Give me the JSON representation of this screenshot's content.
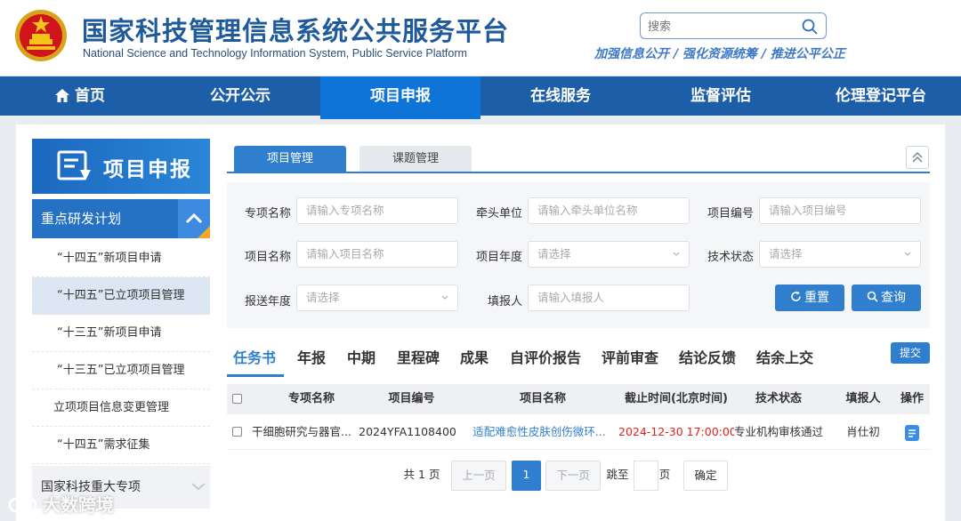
{
  "header": {
    "title_cn": "国家科技管理信息系统公共服务平台",
    "title_en": "National Science and Technology Information System, Public Service Platform",
    "search_placeholder": "搜索",
    "slogan": "加强信息公开 / 强化资源统筹 / 推进公平公正"
  },
  "nav": [
    {
      "label": "首页",
      "icon": "home-icon"
    },
    {
      "label": "公开公示"
    },
    {
      "label": "项目申报",
      "active": true
    },
    {
      "label": "在线服务"
    },
    {
      "label": "监督评估"
    },
    {
      "label": "伦理登记平台"
    }
  ],
  "sidebar": {
    "banner": "项目申报",
    "group1": "重点研发计划",
    "items": [
      "“十四五”新项目申请",
      "“十四五”已立项项目管理",
      "“十三五”新项目申请",
      "“十三五”已立项项目管理",
      "立项项目信息变更管理",
      "“十四五”需求征集"
    ],
    "group2": "国家科技重大专项"
  },
  "tabs": [
    "项目管理",
    "课题管理"
  ],
  "filter": {
    "labels": [
      "专项名称",
      "牵头单位",
      "项目编号",
      "项目名称",
      "项目年度",
      "技术状态",
      "报送年度",
      "填报人"
    ],
    "placeholders": [
      "请输入专项名称",
      "请输入牵头单位名称",
      "请输入项目编号",
      "请输入项目名称",
      "请选择",
      "请选择",
      "请选择",
      "请输入填报人"
    ],
    "reset": "重置",
    "query": "查询"
  },
  "subtabs": [
    "任务书",
    "年报",
    "中期",
    "里程碑",
    "成果",
    "自评价报告",
    "评前审查",
    "结论反馈",
    "结余上交"
  ],
  "submit": "提交",
  "table": {
    "headers": [
      "专项名称",
      "项目编号",
      "项目名称",
      "截止时间(北京时间)",
      "技术状态",
      "填报人",
      "操作"
    ],
    "row": {
      "special": "干细胞研究与器官...",
      "code": "2024YFA1108400",
      "name": "适配难愈性皮肤创伤微环...",
      "deadline": "2024-12-30 17:00:00",
      "status": "专业机构审核通过",
      "user": "肖仕初"
    }
  },
  "pagination": {
    "total": "共 1 页",
    "prev": "上一页",
    "current": "1",
    "next": "下一页",
    "goto": "跳至",
    "page_unit": "页",
    "confirm": "确定"
  },
  "watermark": "大数跨境",
  "colors": {
    "primary": "#1d5ea8",
    "accent": "#2f7fce",
    "deadline": "#e02020",
    "link": "#2f7fce"
  }
}
